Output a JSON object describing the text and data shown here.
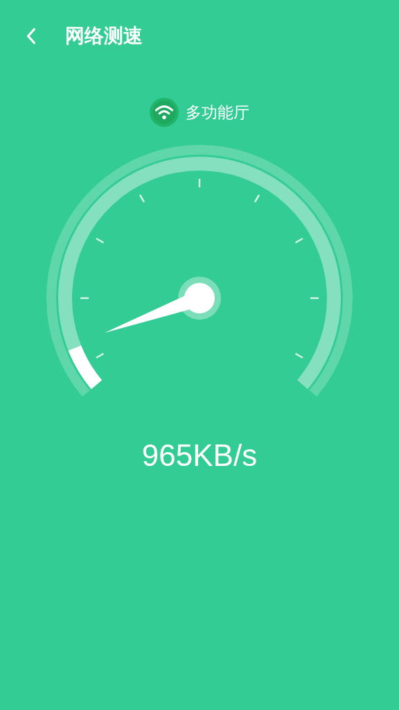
{
  "header": {
    "title": "网络测速"
  },
  "network": {
    "name": "多功能厅"
  },
  "speed": "965KB/s"
}
